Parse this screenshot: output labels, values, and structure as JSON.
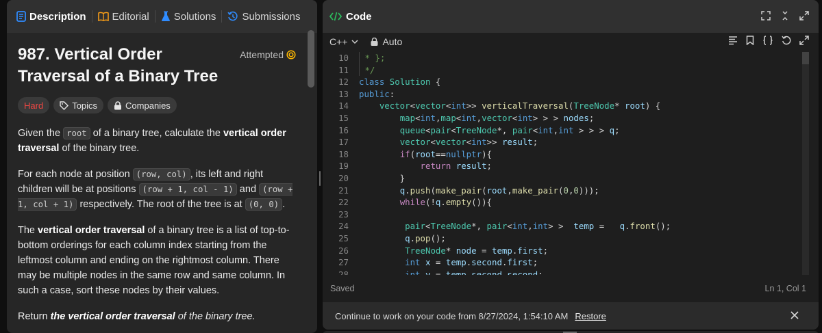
{
  "left": {
    "tabs": [
      {
        "label": "Description",
        "icon": "description-icon",
        "color": "#2f8cff"
      },
      {
        "label": "Editorial",
        "icon": "book-icon",
        "color": "#ffa116"
      },
      {
        "label": "Solutions",
        "icon": "flask-icon",
        "color": "#2f8cff"
      },
      {
        "label": "Submissions",
        "icon": "history-icon",
        "color": "#2f8cff"
      }
    ],
    "title": "987. Vertical Order Traversal of a Binary Tree",
    "status": "Attempted",
    "tags": {
      "difficulty": "Hard",
      "topics": "Topics",
      "companies": "Companies"
    },
    "p1": {
      "a": "Given the ",
      "code": "root",
      "b": " of a binary tree, calculate the ",
      "bold": "vertical order traversal",
      "c": " of the binary tree."
    },
    "p2": {
      "a": "For each node at position ",
      "code1": "(row, col)",
      "b": ", its left and right children will be at positions ",
      "code2": "(row + 1, col - 1)",
      "c": " and ",
      "code3": "(row + 1, col + 1)",
      "d": " respectively. The root of the tree is at ",
      "code4": "(0, 0)",
      "e": "."
    },
    "p3": {
      "a": "The ",
      "bold": "vertical order traversal",
      "b": " of a binary tree is a list of top-to-bottom orderings for each column index starting from the leftmost column and ending on the rightmost column. There may be multiple nodes in the same row and same column. In such a case, sort these nodes by their values."
    },
    "p4": {
      "a": "Return ",
      "bold": "the vertical order traversal",
      "b": " of the binary tree."
    }
  },
  "editor": {
    "title": "Code",
    "language": "C++",
    "mode": "Auto",
    "line_numbers": [
      "10",
      "11",
      "12",
      "13",
      "14",
      "15",
      "16",
      "17",
      "18",
      "19",
      "20",
      "21",
      "22",
      "23",
      "24",
      "25",
      "26",
      "27",
      "28"
    ],
    "status_left": "Saved",
    "status_right": "Ln 1, Col 1",
    "restore_text": "Continue to work on your code from 8/27/2024, 1:54:10 AM",
    "restore_link": "Restore"
  },
  "colors": {
    "hard": "#ef4743",
    "attempted": "#ffb800",
    "code_icon": "#2cbb5d"
  }
}
